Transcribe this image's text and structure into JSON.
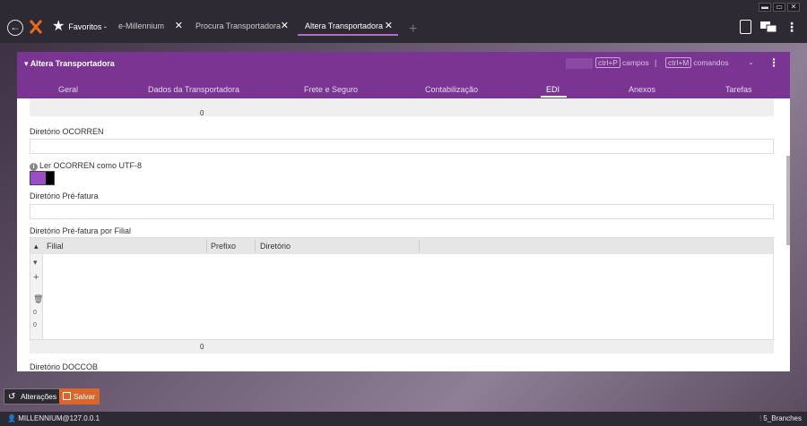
{
  "topbar": {
    "favorites_label": "Favoritos -",
    "tabs": [
      {
        "label": "e-Millennium",
        "close": "✕"
      },
      {
        "label": "Procura Transportadora",
        "close": "✕"
      },
      {
        "label": "Altera Transportadora",
        "close": "✕"
      }
    ],
    "add_tab": "+"
  },
  "panel": {
    "title": "Altera Transportadora",
    "shortcut_fields_key": "ctrl+P",
    "shortcut_fields_label": "campos",
    "separator": "|",
    "shortcut_commands_key": "ctrl+M",
    "shortcut_commands_label": "comandos",
    "tabs": [
      {
        "label": "Geral"
      },
      {
        "label": "Dados da Transportadora"
      },
      {
        "label": "Frete e Seguro"
      },
      {
        "label": "Contabilização"
      },
      {
        "label": "EDI"
      },
      {
        "label": "Anexos"
      },
      {
        "label": "Tarefas"
      }
    ]
  },
  "content": {
    "top_grid_count": "0",
    "dir_ocorren_label": "Diretório OCORREN",
    "utf8_label": "Ler OCORREN como UTF-8",
    "utf8_on": true,
    "dir_prefatura_label": "Diretório Pré-fatura",
    "dir_prefatura_filial_label": "Diretório Pré-fatura por Filial",
    "grid": {
      "columns": [
        "Filial",
        "Prefixo",
        "Diretório"
      ],
      "side_counts": [
        "0",
        "0"
      ],
      "count": "0"
    },
    "dir_doccob_label": "Diretório DOCCOB"
  },
  "footer": {
    "changes_label": "Alterações",
    "save_label": "Salvar",
    "user": "MILLENNIUM@127.0.0.1",
    "branch": "5_Branches"
  },
  "colors": {
    "accent": "#7a3491",
    "save": "#d9662a",
    "toggle": "#9b4dc2"
  }
}
